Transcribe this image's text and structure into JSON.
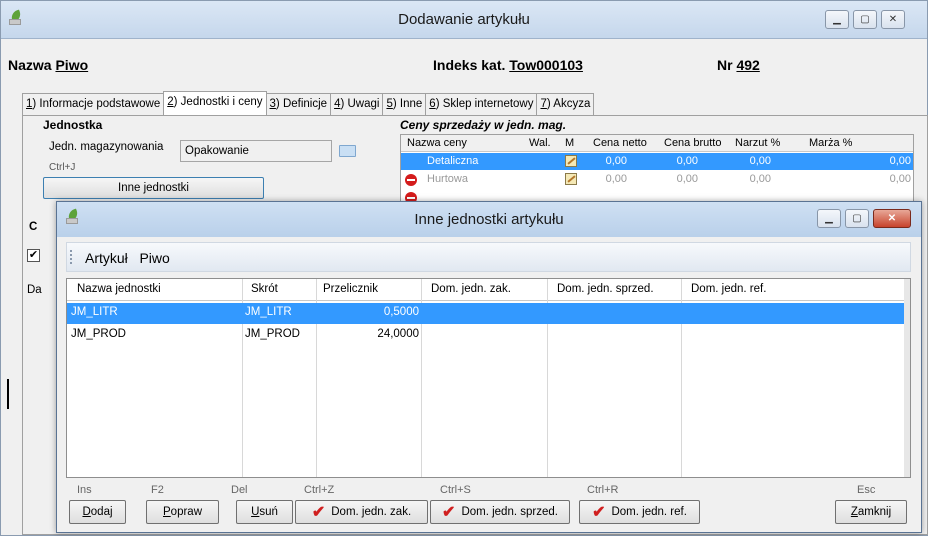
{
  "main_window": {
    "title": "Dodawanie artykułu",
    "name_label": "Nazwa",
    "name_value": "Piwo",
    "index_label": "Indeks kat.",
    "index_value": "Tow000103",
    "nr_label": "Nr",
    "nr_value": "492",
    "tabs": [
      {
        "key": "1",
        "label": ") Informacje podstawowe"
      },
      {
        "key": "2",
        "label": ") Jednostki i ceny"
      },
      {
        "key": "3",
        "label": ") Definicje"
      },
      {
        "key": "4",
        "label": ") Uwagi"
      },
      {
        "key": "5",
        "label": ") Inne"
      },
      {
        "key": "6",
        "label": ") Sklep internetowy"
      },
      {
        "key": "7",
        "label": ") Akcyza"
      }
    ],
    "unit_group": {
      "title": "Jednostka",
      "storage_label": "Jedn. magazynowania",
      "storage_value": "Opakowanie",
      "shortcut": "Ctrl+J",
      "other_units_button": "Inne jednostki"
    },
    "side_fragments": [
      "C",
      "Da"
    ],
    "prices": {
      "title": "Ceny sprzedaży w jedn. mag.",
      "columns": [
        "Nazwa ceny",
        "Wal.",
        "M",
        "Cena netto",
        "Cena brutto",
        "Narzut %",
        "Marża %"
      ],
      "rows": [
        {
          "name": "Detaliczna",
          "net": "0,00",
          "gross": "0,00",
          "markup": "0,00",
          "margin": "0,00"
        },
        {
          "name": "Hurtowa",
          "net": "0,00",
          "gross": "0,00",
          "markup": "0,00",
          "margin": "0,00"
        }
      ]
    }
  },
  "dialog": {
    "title": "Inne jednostki artykułu",
    "toolbar_label": "Artykuł",
    "toolbar_value": "Piwo",
    "columns": [
      "Nazwa jednostki",
      "Skrót",
      "Przelicznik",
      "Dom. jedn. zak.",
      "Dom. jedn. sprzed.",
      "Dom. jedn. ref."
    ],
    "rows": [
      {
        "name": "JM_LITR",
        "short": "JM_LITR",
        "factor": "0,5000"
      },
      {
        "name": "JM_PROD",
        "short": "JM_PROD",
        "factor": "24,0000"
      }
    ],
    "shortcuts": {
      "add": "Ins",
      "edit": "F2",
      "delete": "Del",
      "purchase": "Ctrl+Z",
      "sale": "Ctrl+S",
      "ref": "Ctrl+R",
      "close": "Esc"
    },
    "buttons": {
      "add": {
        "first": "D",
        "rest": "odaj"
      },
      "edit": {
        "first": "P",
        "rest": "opraw"
      },
      "delete": {
        "first": "U",
        "rest": "suń"
      },
      "purchase": "Dom. jedn. zak.",
      "sale": "Dom. jedn. sprzed.",
      "ref": "Dom. jedn. ref.",
      "close": {
        "first": "Z",
        "rest": "amknij"
      }
    }
  },
  "colors": {
    "selection": "#3399ff",
    "check": "#d01f1f",
    "no_entry": "#d41c1c"
  }
}
